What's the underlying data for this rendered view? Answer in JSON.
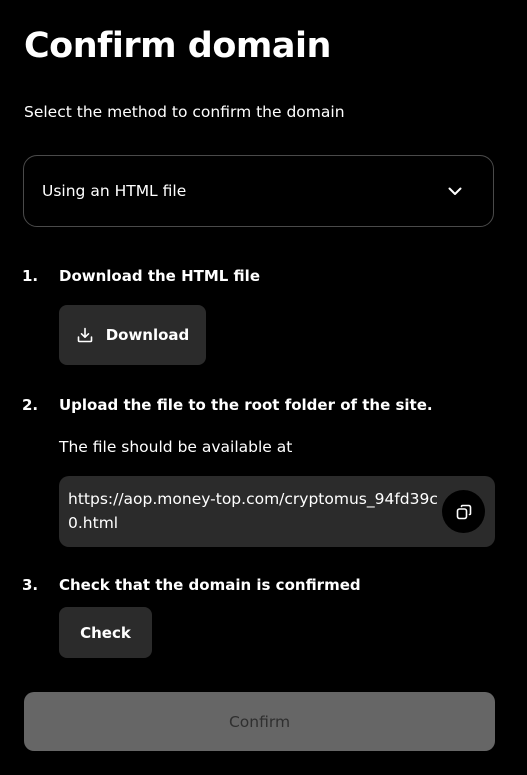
{
  "page": {
    "title": "Confirm domain",
    "subtitle": "Select the method to confirm the domain"
  },
  "method_select": {
    "value": "Using an HTML file",
    "icon": "chevron-down-icon"
  },
  "steps": [
    {
      "number": "1.",
      "title": "Download the HTML file",
      "button": {
        "label": "Download",
        "icon": "download-icon"
      }
    },
    {
      "number": "2.",
      "title": "Upload the file to the root folder of the site.",
      "note": "The file should be available at",
      "url": "https://aop.money-top.com/cryptomus_94fd39c0.html",
      "copy_icon": "copy-icon"
    },
    {
      "number": "3.",
      "title": "Check that the domain is confirmed",
      "button": {
        "label": "Check"
      }
    }
  ],
  "confirm_button": {
    "label": "Confirm",
    "state": "disabled"
  },
  "colors": {
    "background": "#000000",
    "text": "#ffffff",
    "surface": "#2b2b2b",
    "border": "#4a4a4a",
    "disabled_bg": "#666666",
    "disabled_text": "#2f2f2f"
  }
}
